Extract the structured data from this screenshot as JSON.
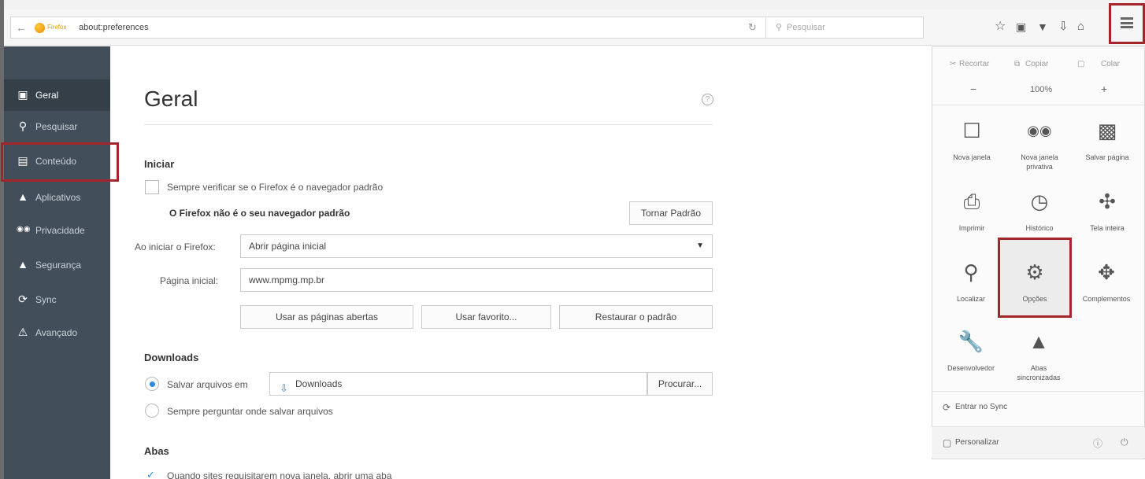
{
  "browser": {
    "brand_label": "Firefox",
    "url": "about:preferences",
    "search_placeholder": "Pesquisar"
  },
  "sidebar": {
    "items": [
      {
        "label": "Geral",
        "icon": "general-icon",
        "active": true
      },
      {
        "label": "Pesquisar",
        "icon": "search-icon"
      },
      {
        "label": "Conteúdo",
        "icon": "document-icon"
      },
      {
        "label": "Aplicativos",
        "icon": "rocket-icon"
      },
      {
        "label": "Privacidade",
        "icon": "mask-icon"
      },
      {
        "label": "Segurança",
        "icon": "lock-icon"
      },
      {
        "label": "Sync",
        "icon": "sync-icon"
      },
      {
        "label": "Avançado",
        "icon": "warning-icon"
      }
    ]
  },
  "main": {
    "title": "Geral",
    "startup": {
      "heading": "Iniciar",
      "default_check_label": "Sempre verificar se o Firefox é o navegador padrão",
      "not_default_text": "O Firefox não é o seu navegador padrão",
      "make_default_button": "Tornar Padrão",
      "when_starts_label": "Ao iniciar o Firefox:",
      "when_starts_value": "Abrir página inicial",
      "homepage_label": "Página inicial:",
      "homepage_value": "www.mpmg.mp.br",
      "use_current_button": "Usar as páginas abertas",
      "use_bookmark_button": "Usar favorito...",
      "restore_default_button": "Restaurar o padrão"
    },
    "downloads": {
      "heading": "Downloads",
      "save_to_label": "Salvar arquivos em",
      "save_to_folder": "Downloads",
      "browse_button": "Procurar...",
      "always_ask_label": "Sempre perguntar onde salvar arquivos"
    },
    "tabs": {
      "heading": "Abas",
      "open_new_windows_label": "Quando sites requisitarem nova janela, abrir uma aba"
    }
  },
  "menu_panel": {
    "cut": "Recortar",
    "copy": "Copiar",
    "paste": "Colar",
    "zoom_out": "−",
    "zoom_level": "100%",
    "zoom_in": "+",
    "items": [
      {
        "label": "Nova janela",
        "icon": "window-icon"
      },
      {
        "label": "Nova janela privativa",
        "icon": "mask-icon"
      },
      {
        "label": "Salvar página",
        "icon": "page-icon"
      },
      {
        "label": "Imprimir",
        "icon": "print-icon"
      },
      {
        "label": "Histórico",
        "icon": "clock-icon"
      },
      {
        "label": "Tela inteira",
        "icon": "fullscreen-icon"
      },
      {
        "label": "Localizar",
        "icon": "magnifier-icon"
      },
      {
        "label": "Opções",
        "icon": "gear-icon"
      },
      {
        "label": "Complementos",
        "icon": "puzzle-icon"
      },
      {
        "label": "Desenvolvedor",
        "icon": "wrench-icon"
      },
      {
        "label": "Abas sincronizadas",
        "icon": "synced-tabs-icon"
      }
    ],
    "sync_label": "Entrar no Sync",
    "customize_label": "Personalizar"
  },
  "colors": {
    "highlight": "#a4252b",
    "sidebar_bg": "#424f5a",
    "accent": "#2a8be6"
  }
}
